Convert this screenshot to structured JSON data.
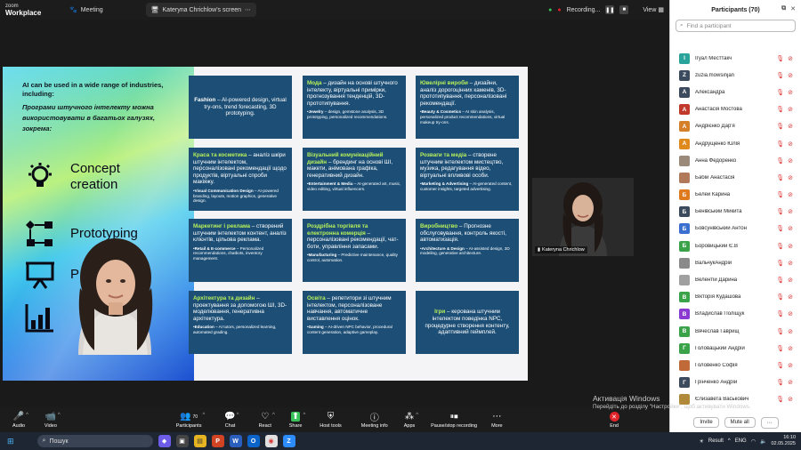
{
  "app": {
    "brand_top": "zoom",
    "brand_bottom": "Workplace",
    "meeting_label": "Meeting"
  },
  "share_pill": {
    "label": "Kateryna Chrichlow's screen"
  },
  "topbar_right": {
    "recording": "Recording...",
    "view": "View"
  },
  "slide": {
    "intro_en": "AI can be used in a wide range of industries, including:",
    "intro_ua": "Програми штучного інтелекту можна використовувати в багатьох галузях, зокрема:",
    "industries": [
      {
        "icon": "lightbulb-gear-icon",
        "label": "Concept creation"
      },
      {
        "icon": "flowchart-icon",
        "label": "Prototyping"
      },
      {
        "icon": "presentation-board-icon",
        "label": "P"
      },
      {
        "icon": "bar-chart-icon",
        "label": ""
      }
    ],
    "cards": [
      {
        "title": "",
        "center_lead": "Fashion",
        "center_text": " – AI-powered design, virtual try-ons, trend forecasting, 3D prototyping.",
        "body": "",
        "bullet_lead": "",
        "bullet_text": ""
      },
      {
        "title": "Мода",
        "body": " – дизайн на основі штучного інтелекту, віртуальні примірки, прогнозування тенденцій, 3D-прототипування.",
        "bullet_lead": "Jewelry",
        "bullet_text": " – design, gemstone analysis, 3D prototyping, personalized recommendations."
      },
      {
        "title": "Ювелірні вироби",
        "body": " – дизайни, аналіз дорогоцінних каменів, 3D-прототипування, персоналізовані рекомендації.",
        "bullet_lead": "Beauty & Cosmetics",
        "bullet_text": " – AI skin analysis, personalized product recommendations, virtual makeup try-ons."
      },
      {
        "title": "Краса та косметика",
        "body": " – аналіз шкіри штучним інтелектом, персоналізовані рекомендації щодо продуктів, віртуальні спроби макіяжу.",
        "bullet_lead": "Visual Communication Design",
        "bullet_text": " – AI-powered branding, layouts, motion graphics, generative design."
      },
      {
        "title": "Візуальний комунікаційний дизайн",
        "body": " – брендинг на основі ШІ, макети, анімована графіка, генеративний дизайн.",
        "bullet_lead": "Entertainment & Media",
        "bullet_text": " – AI-generated art, music, video editing, virtual influencers."
      },
      {
        "title": "Розваги та медіа",
        "body": " – створене штучним інтелектом мистецтво, музика, редагування відео, віртуальні впливові особи.",
        "bullet_lead": "Marketing & Advertising",
        "bullet_text": " – AI-generated content, customer insights, targeted advertising."
      },
      {
        "title": "Маркетинг і реклама",
        "body": " – створений штучним інтелектом контент, аналіз клієнтів, цільова реклама.",
        "bullet_lead": "Retail & E-commerce",
        "bullet_text": " – Personalized recommendations, chatbots, inventory management."
      },
      {
        "title": "Роздрібна торгівля та електронна комерція",
        "body": " – персоналізовані рекомендації, чат-боти, управління запасами.",
        "bullet_lead": "Manufacturing",
        "bullet_text": " – Predictive maintenance, quality control, automation."
      },
      {
        "title": "Виробництво",
        "body": " – Прогнозне обслуговування, контроль якості, автоматизація.",
        "bullet_lead": "Architecture & Design",
        "bullet_text": " – AI-assisted design, 3D modeling, generative architecture."
      },
      {
        "title": "Архітектура та дизайн",
        "body": " – проектування за допомогою ШІ, 3D-моделювання, генеративна архітектура.",
        "bullet_lead": "Education",
        "bullet_text": " – AI tutors, personalized learning, automated grading."
      },
      {
        "title": "Освіта",
        "body": " – репетитори зі штучним інтелектом, персоналізоване навчання, автоматичне виставлення оцінок.",
        "bullet_lead": "Gaming",
        "bullet_text": " – AI-driven NPC behavior, procedural content generation, adaptive gameplay."
      },
      {
        "title": "",
        "center_lead": "Ігри",
        "center_text": " – керована штучним інтелектом поведінка NPC, процедурне створення контенту, адаптивний геймплей.",
        "body": "",
        "bullet_lead": "",
        "bullet_text": ""
      }
    ]
  },
  "video_tile": {
    "name": "Kateryna Chrichlow"
  },
  "toolbar": {
    "audio": "Audio",
    "video": "Video",
    "participants": "Participants",
    "participants_count": "70",
    "chat": "Chat",
    "react": "React",
    "share": "Share",
    "host_tools": "Host tools",
    "meeting_info": "Meeting info",
    "apps": "Apps",
    "record": "Pause/stop recording",
    "more": "More",
    "end": "End"
  },
  "panel": {
    "title": "Participants (70)",
    "search_placeholder": "Find a participant",
    "participants": [
      {
        "initial": "I",
        "color": "#2aa39a",
        "name": "Ігуал Месттакч"
      },
      {
        "initial": "Z",
        "color": "#3b4a5c",
        "name": "zuzia.mowsinjan"
      },
      {
        "initial": "А",
        "color": "#3b4a5c",
        "name": "Александра"
      },
      {
        "initial": "А",
        "color": "#c0392b",
        "name": "Анастасія Мостова"
      },
      {
        "initial": "А",
        "color": "#d4802a",
        "name": "Андрієнко Дар'я"
      },
      {
        "initial": "А",
        "color": "#e08a1e",
        "name": "Андрущенко Юлія"
      },
      {
        "initial": "",
        "color": "#9b8a7a",
        "name": "Анна Федоренко"
      },
      {
        "initial": "",
        "color": "#b07a5a",
        "name": "Бабій Анастасія"
      },
      {
        "initial": "Б",
        "color": "#e07a1e",
        "name": "Белей Карина"
      },
      {
        "initial": "Б",
        "color": "#3b4a5c",
        "name": "Бенівський Микита"
      },
      {
        "initial": "Б",
        "color": "#3a6fd0",
        "name": "Бовсунівський Антон"
      },
      {
        "initial": "Б",
        "color": "#3aa34a",
        "name": "Боровицький Є.В"
      },
      {
        "initial": "",
        "color": "#8a8a8a",
        "name": "ВальчукАндрій"
      },
      {
        "initial": "",
        "color": "#a0a0a0",
        "name": "Велентій Дарина"
      },
      {
        "initial": "В",
        "color": "#3aa34a",
        "name": "Вікторія Кудашова"
      },
      {
        "initial": "В",
        "color": "#8a3ad0",
        "name": "Владислав Поліщук"
      },
      {
        "initial": "В",
        "color": "#3aa34a",
        "name": "Вячеслав Гаврищ"
      },
      {
        "initial": "Г",
        "color": "#3aa34a",
        "name": "Головацький Андрій"
      },
      {
        "initial": "",
        "color": "#c06a3a",
        "name": "Головенко Софія"
      },
      {
        "initial": "Г",
        "color": "#3b4a5c",
        "name": "Грінченко Андрій"
      },
      {
        "initial": "",
        "color": "#b08a3a",
        "name": "Єлизавета Васькович"
      }
    ],
    "invite": "Invite",
    "mute_all": "Mute all"
  },
  "watermark": {
    "line1": "Активація Windows",
    "line2": "Перейдіть до розділу \"Настройки\", щоб активувати Windows."
  },
  "taskbar": {
    "search": "Пошук",
    "weather": "Result",
    "lang": "ENG",
    "time": "16:10",
    "date": "02.05.2025"
  }
}
